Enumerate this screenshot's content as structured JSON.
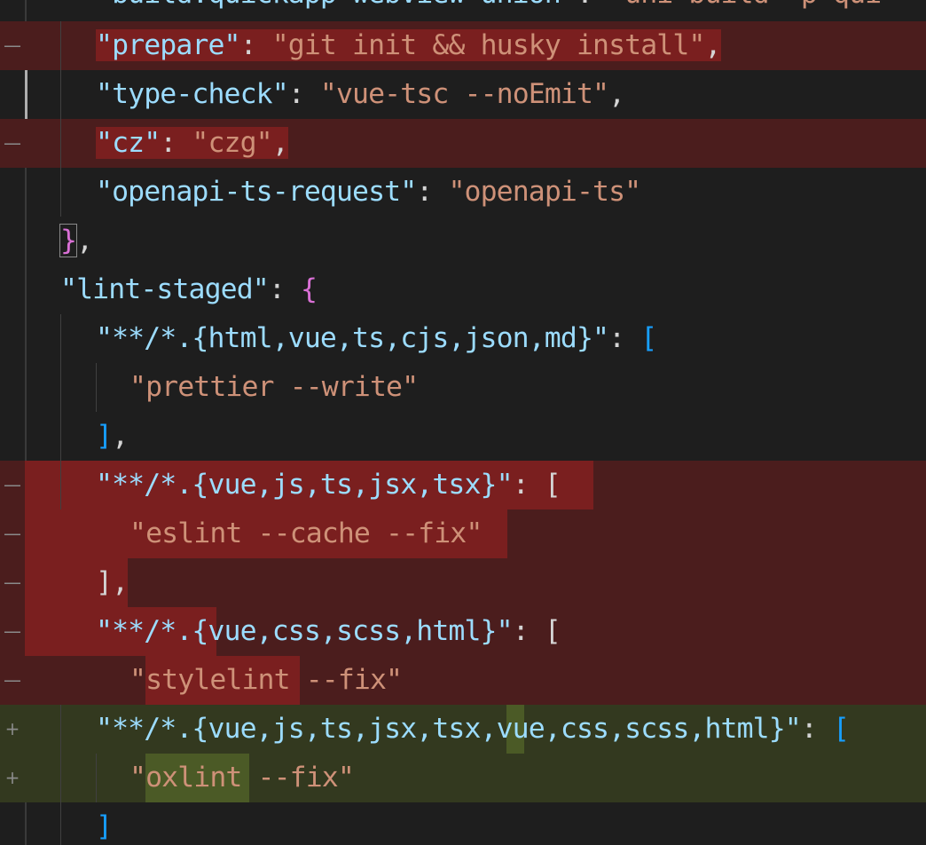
{
  "editor": {
    "top_partial": {
      "key": "\"build:quickapp-webview-union\"",
      "sep": ": ",
      "value": "\"uni build -p qui"
    },
    "lines": [
      {
        "id": "prepare",
        "gutter": "—",
        "kind": "del",
        "key": "\"prepare\"",
        "sep": ": ",
        "value": "\"git init && husky install\"",
        "tail": ","
      },
      {
        "id": "type-check",
        "gutter": "",
        "kind": "ctx",
        "key": "\"type-check\"",
        "sep": ": ",
        "value": "\"vue-tsc --noEmit\"",
        "tail": ","
      },
      {
        "id": "cz",
        "gutter": "—",
        "kind": "del",
        "key": "\"cz\"",
        "sep": ": ",
        "value": "\"czg\"",
        "tail": ","
      },
      {
        "id": "openapi",
        "gutter": "",
        "kind": "ctx",
        "key": "\"openapi-ts-request\"",
        "sep": ": ",
        "value": "\"openapi-ts\"",
        "tail": ""
      },
      {
        "id": "close-scripts",
        "gutter": "",
        "kind": "ctx",
        "bracket": "}",
        "tail": ","
      },
      {
        "id": "lint-staged",
        "gutter": "",
        "kind": "ctx",
        "key": "\"lint-staged\"",
        "sep": ": ",
        "bracket": "{",
        "tail": ""
      },
      {
        "id": "glob-prettier",
        "gutter": "",
        "kind": "ctx",
        "key": "\"**/*.{html,vue,ts,cjs,json,md}\"",
        "sep": ": ",
        "bracket": "[",
        "tail": ""
      },
      {
        "id": "prettier",
        "gutter": "",
        "kind": "ctx",
        "value": "\"prettier --write\""
      },
      {
        "id": "close-prettier",
        "gutter": "",
        "kind": "ctx",
        "bracket": "]",
        "tail": ","
      },
      {
        "id": "glob-eslint",
        "gutter": "—",
        "kind": "del",
        "key": "\"**/*.{vue,js,ts,jsx,tsx}\"",
        "sep": ": ",
        "bracket": "[",
        "tail": ""
      },
      {
        "id": "eslint",
        "gutter": "—",
        "kind": "del",
        "value": "\"eslint --cache --fix\""
      },
      {
        "id": "close-eslint",
        "gutter": "—",
        "kind": "del",
        "bracket": "]",
        "tail": ","
      },
      {
        "id": "glob-stylelint",
        "gutter": "—",
        "kind": "del",
        "key": "\"**/*.{vue,css,scss,html}\"",
        "sep": ": ",
        "bracket": "[",
        "tail": ""
      },
      {
        "id": "stylelint",
        "gutter": "—",
        "kind": "del",
        "value": "\"stylelint --fix\""
      },
      {
        "id": "glob-oxlint",
        "gutter": "+",
        "kind": "add",
        "key": "\"**/*.{vue,js,ts,jsx,tsx,vue,css,scss,html}\"",
        "sep": ": ",
        "bracket": "[",
        "tail": ""
      },
      {
        "id": "oxlint",
        "gutter": "+",
        "kind": "add",
        "value": "\"oxlint --fix\""
      },
      {
        "id": "close-oxlint",
        "gutter": "",
        "kind": "ctx",
        "bracket": "]",
        "tail": ""
      }
    ]
  },
  "colors": {
    "background": "#1e1e1e",
    "json_key": "#9cdcfe",
    "json_string": "#ce9178",
    "punctuation": "#d4d4d4",
    "bracket_level1": "#da70d6",
    "bracket_level2": "#179fff",
    "deleted_line": "#4b1d1d",
    "deleted_highlight": "#7a1f1f",
    "added_line": "#33391f",
    "added_highlight": "#4b5a26"
  }
}
